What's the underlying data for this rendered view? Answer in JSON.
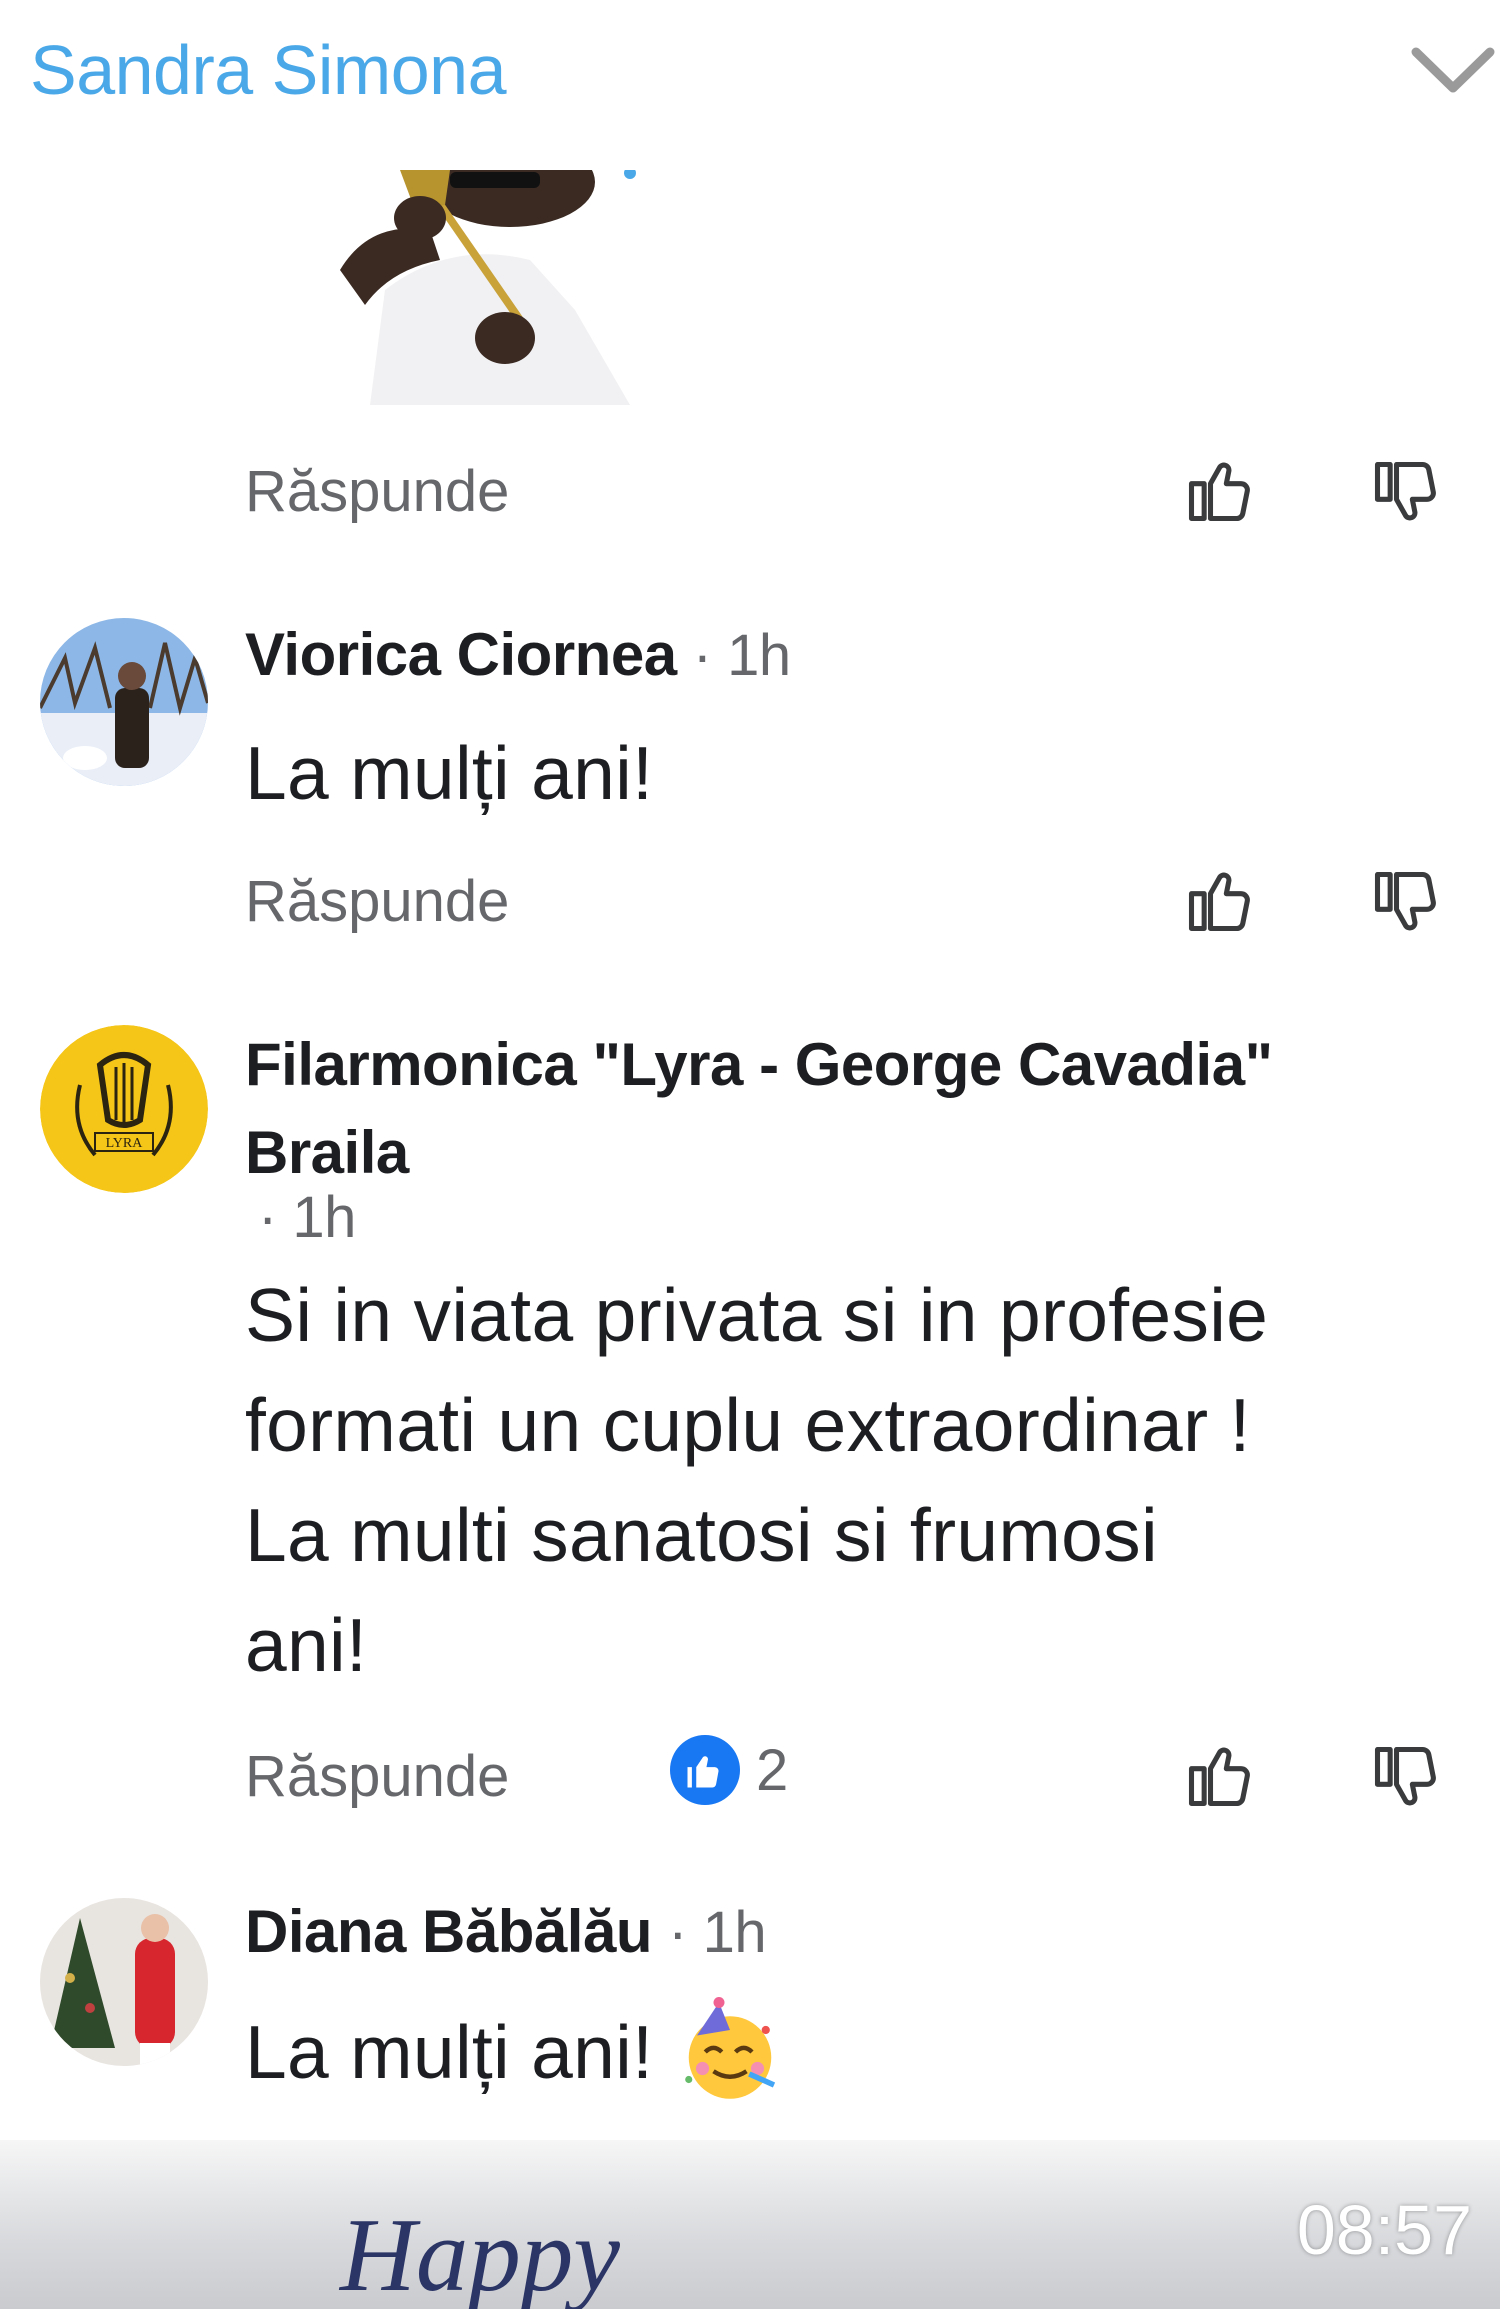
{
  "header": {
    "title": "Sandra Simona"
  },
  "actions": {
    "reply_label": "Răspunde"
  },
  "comments": [
    {
      "author": "Viorica Ciornea",
      "time": "· 1h",
      "text": "La mulți ani!"
    },
    {
      "author_line1": "Filarmonica \"Lyra - George Cavadia\"",
      "author_line2": "Braila",
      "time": "· 1h",
      "text_lines": [
        "Si in viata privata si in profesie",
        "formati un cuplu extraordinar !",
        "La multi sanatosi si frumosi",
        "ani!"
      ],
      "reaction_count": "2",
      "logo_text": "LYRA"
    },
    {
      "author": "Diana Băbălău",
      "time": "· 1h",
      "text": "La mulți ani!"
    }
  ],
  "video": {
    "timestamp": "08:57",
    "overlay_text": "Happy"
  },
  "colors": {
    "accent": "#4aa8e8",
    "like_blue": "#1877f2",
    "secondary_text": "#65676b"
  }
}
